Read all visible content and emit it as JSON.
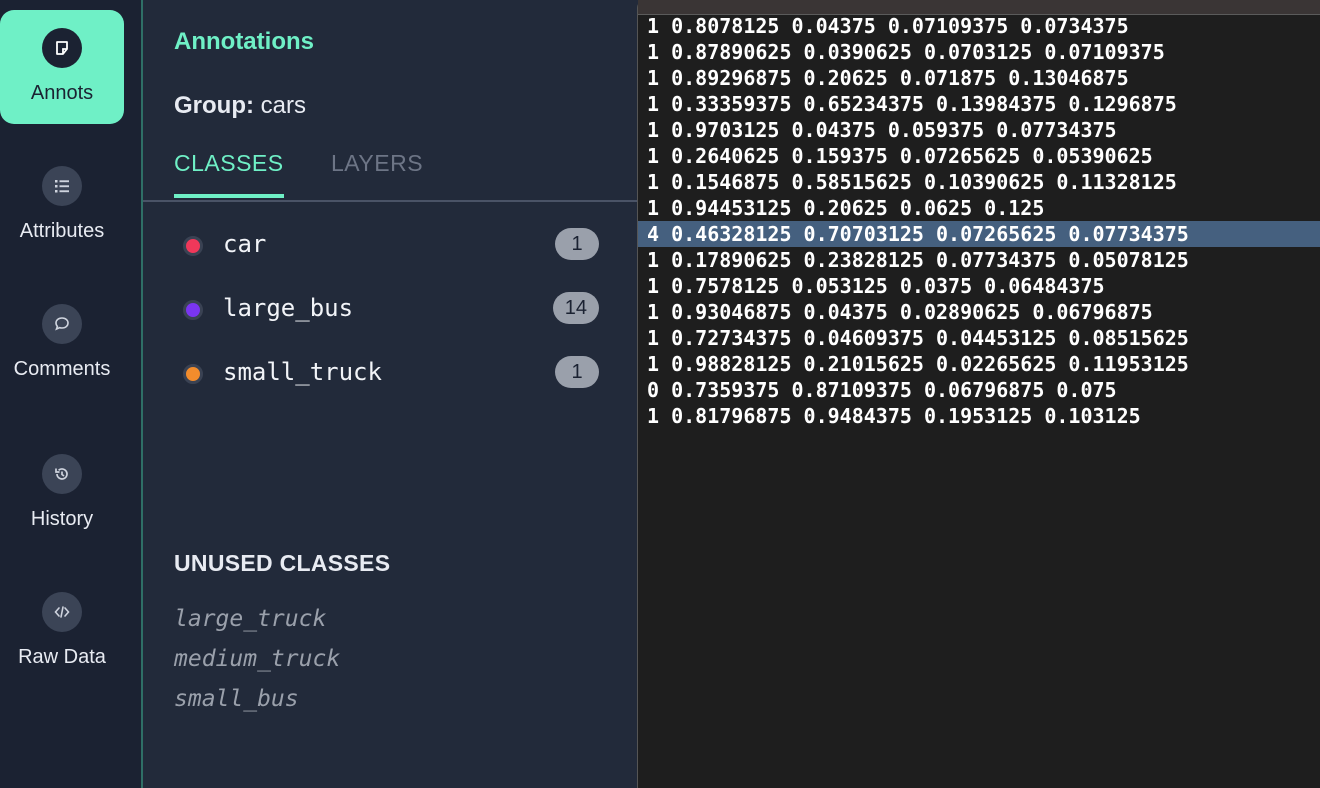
{
  "rail": {
    "items": [
      {
        "label": "Annots",
        "icon": "note-icon",
        "active": true
      },
      {
        "label": "Attributes",
        "icon": "list-icon",
        "active": false
      },
      {
        "label": "Comments",
        "icon": "comment-icon",
        "active": false
      },
      {
        "label": "History",
        "icon": "history-icon",
        "active": false
      },
      {
        "label": "Raw Data",
        "icon": "code-icon",
        "active": false
      }
    ]
  },
  "panel": {
    "title": "Annotations",
    "group_label": "Group:",
    "group_value": "cars",
    "tabs": [
      "CLASSES",
      "LAYERS"
    ],
    "active_tab": "CLASSES",
    "classes": [
      {
        "name": "car",
        "count": "1",
        "color": "#f0385a"
      },
      {
        "name": "large_bus",
        "count": "14",
        "color": "#7a35f0"
      },
      {
        "name": "small_truck",
        "count": "1",
        "color": "#f28c2c"
      }
    ],
    "unused_title": "UNUSED CLASSES",
    "unused": [
      "large_truck",
      "medium_truck",
      "small_bus"
    ]
  },
  "raw_data": {
    "highlighted_index": 8,
    "lines": [
      "1 0.8078125 0.04375 0.07109375 0.0734375",
      "1 0.87890625 0.0390625 0.0703125 0.07109375",
      "1 0.89296875 0.20625 0.071875 0.13046875",
      "1 0.33359375 0.65234375 0.13984375 0.1296875",
      "1 0.9703125 0.04375 0.059375 0.07734375",
      "1 0.2640625 0.159375 0.07265625 0.05390625",
      "1 0.1546875 0.58515625 0.10390625 0.11328125",
      "1 0.94453125 0.20625 0.0625 0.125",
      "4 0.46328125 0.70703125 0.07265625 0.07734375",
      "1 0.17890625 0.23828125 0.07734375 0.05078125",
      "1 0.7578125 0.053125 0.0375 0.06484375",
      "1 0.93046875 0.04375 0.02890625 0.06796875",
      "1 0.72734375 0.04609375 0.04453125 0.08515625",
      "1 0.98828125 0.21015625 0.02265625 0.11953125",
      "0 0.7359375 0.87109375 0.06796875 0.075",
      "1 0.81796875 0.9484375 0.1953125 0.103125"
    ]
  }
}
